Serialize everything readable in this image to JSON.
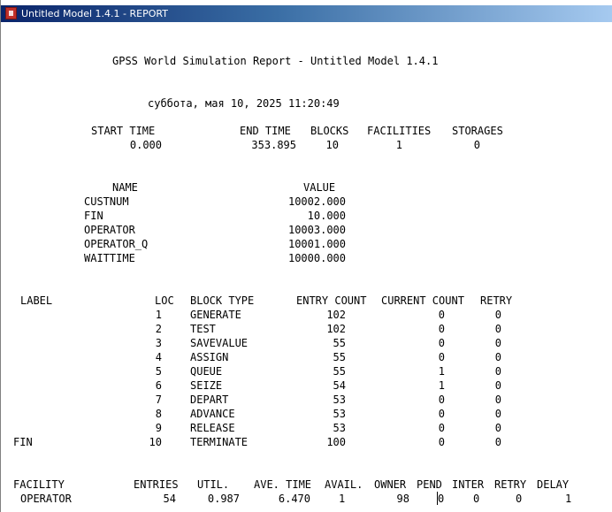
{
  "window": {
    "title": "Untitled Model 1.4.1 - REPORT",
    "icon": "gpss-report-icon"
  },
  "report": {
    "heading": "GPSS World Simulation Report - Untitled Model 1.4.1",
    "date": "суббота, мая 10, 2025 11:20:49",
    "summary": {
      "headers": [
        "START TIME",
        "END TIME",
        "BLOCKS",
        "FACILITIES",
        "STORAGES"
      ],
      "values": [
        "0.000",
        "353.895",
        "10",
        "1",
        "0"
      ]
    },
    "names": {
      "header_name": "NAME",
      "header_value": "VALUE",
      "rows": [
        {
          "name": "CUSTNUM",
          "value": "10002.000"
        },
        {
          "name": "FIN",
          "value": "10.000"
        },
        {
          "name": "OPERATOR",
          "value": "10003.000"
        },
        {
          "name": "OPERATOR_Q",
          "value": "10001.000"
        },
        {
          "name": "WAITTIME",
          "value": "10000.000"
        }
      ]
    },
    "blocks": {
      "headers": {
        "label": "LABEL",
        "loc": "LOC",
        "type": "BLOCK TYPE",
        "entry": "ENTRY COUNT",
        "current": "CURRENT COUNT",
        "retry": "RETRY"
      },
      "rows": [
        {
          "label": "",
          "loc": "1",
          "type": "GENERATE",
          "entry": "102",
          "current": "0",
          "retry": "0"
        },
        {
          "label": "",
          "loc": "2",
          "type": "TEST",
          "entry": "102",
          "current": "0",
          "retry": "0"
        },
        {
          "label": "",
          "loc": "3",
          "type": "SAVEVALUE",
          "entry": "55",
          "current": "0",
          "retry": "0"
        },
        {
          "label": "",
          "loc": "4",
          "type": "ASSIGN",
          "entry": "55",
          "current": "0",
          "retry": "0"
        },
        {
          "label": "",
          "loc": "5",
          "type": "QUEUE",
          "entry": "55",
          "current": "1",
          "retry": "0"
        },
        {
          "label": "",
          "loc": "6",
          "type": "SEIZE",
          "entry": "54",
          "current": "1",
          "retry": "0"
        },
        {
          "label": "",
          "loc": "7",
          "type": "DEPART",
          "entry": "53",
          "current": "0",
          "retry": "0"
        },
        {
          "label": "",
          "loc": "8",
          "type": "ADVANCE",
          "entry": "53",
          "current": "0",
          "retry": "0"
        },
        {
          "label": "",
          "loc": "9",
          "type": "RELEASE",
          "entry": "53",
          "current": "0",
          "retry": "0"
        },
        {
          "label": "FIN",
          "loc": "10",
          "type": "TERMINATE",
          "entry": "100",
          "current": "0",
          "retry": "0"
        }
      ]
    },
    "facility": {
      "headers": {
        "facility": "FACILITY",
        "entries": "ENTRIES",
        "util": "UTIL.",
        "ave_time": "AVE. TIME",
        "avail": "AVAIL.",
        "owner": "OWNER",
        "pend": "PEND",
        "inter": "INTER",
        "retry": "RETRY",
        "delay": "DELAY"
      },
      "rows": [
        {
          "facility": "OPERATOR",
          "entries": "54",
          "util": "0.987",
          "ave_time": "6.470",
          "avail": "1",
          "owner": "98",
          "pend": "0",
          "inter": "0",
          "retry": "0",
          "delay": "1"
        }
      ]
    }
  }
}
